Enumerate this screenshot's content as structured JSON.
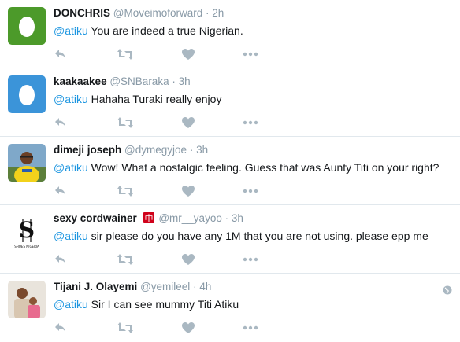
{
  "tweets": [
    {
      "name": "DONCHRIS",
      "handle": "@Moveimoforward",
      "time": "2h",
      "mention": "@atiku",
      "text": " You are indeed a true Nigerian.",
      "avatar": "egg-green"
    },
    {
      "name": "kaakaakee",
      "handle": "@SNBaraka",
      "time": "3h",
      "mention": "@atiku",
      "text": " Hahaha Turaki really enjoy",
      "avatar": "egg-blue"
    },
    {
      "name": "dimeji joseph",
      "handle": "@dymegyjoe",
      "time": "3h",
      "mention": "@atiku",
      "text": " Wow! What a nostalgic feeling. Guess that was Aunty Titi on your right?",
      "avatar": "photo-yellow-shirt"
    },
    {
      "name": "sexy cordwainer",
      "handle": "@mr__yayoo",
      "time": "3h",
      "mention": "@atiku",
      "text": " sir please do you have any 1M that you are not using. please epp me",
      "avatar": "logo-s",
      "badge": "中"
    },
    {
      "name": "Tijani J. Olayemi",
      "handle": "@yemileel",
      "time": "4h",
      "mention": "@atiku",
      "text": " Sir I can see mummy Titi Atiku",
      "avatar": "photo-family",
      "globe_icon": "globe-icon"
    }
  ],
  "separator": "·",
  "avatar_logo_text": "SHOES NIGERIA",
  "colors": {
    "name": "#14171a",
    "meta": "#8899a6",
    "mention": "#1b95e0",
    "action": "#aab8c2",
    "divider": "#e1e8ed",
    "egg_green": "#4c9a2a",
    "egg_blue": "#3b94d9",
    "badge": "#d0021b"
  },
  "icons": [
    "reply-icon",
    "retweet-icon",
    "like-icon",
    "more-icon",
    "globe-icon"
  ]
}
